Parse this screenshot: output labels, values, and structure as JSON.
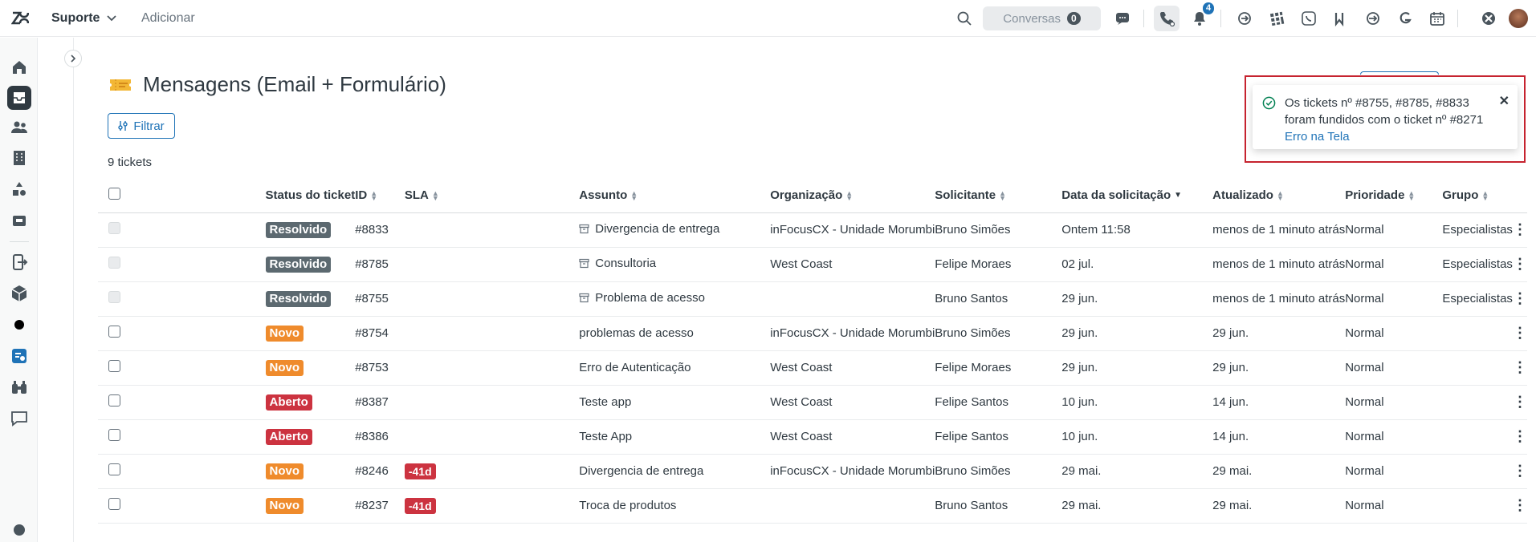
{
  "header": {
    "product": "Suporte",
    "add": "Adicionar",
    "conversations_label": "Conversas",
    "conversations_count": "0",
    "notification_count": "4"
  },
  "view": {
    "title": "Mensagens (Email + Formulário)",
    "filter_label": "Filtrar",
    "ticket_count": "9 tickets"
  },
  "columns": [
    "Status do ticket",
    "ID",
    "SLA",
    "Assunto",
    "Organização",
    "Solicitante",
    "Data da solicitação",
    "Atualizado",
    "Prioridade",
    "Grupo"
  ],
  "rows": [
    {
      "status": "Resolvido",
      "status_color": "#5c6970",
      "id": "#8833",
      "sla": "",
      "archived": true,
      "subject": "Divergencia de entrega",
      "org": "inFocusCX - Unidade Morumbi",
      "requester": "Bruno Simões",
      "requested": "Ontem 11:58",
      "updated": "menos de 1 minuto atrás",
      "priority": "Normal",
      "group": "Especialistas",
      "disabled": true
    },
    {
      "status": "Resolvido",
      "status_color": "#5c6970",
      "id": "#8785",
      "sla": "",
      "archived": true,
      "subject": "Consultoria",
      "org": "West Coast",
      "requester": "Felipe Moraes",
      "requested": "02 jul.",
      "updated": "menos de 1 minuto atrás",
      "priority": "Normal",
      "group": "Especialistas",
      "disabled": true
    },
    {
      "status": "Resolvido",
      "status_color": "#5c6970",
      "id": "#8755",
      "sla": "",
      "archived": true,
      "subject": "Problema de acesso",
      "org": "",
      "requester": "Bruno Santos",
      "requested": "29 jun.",
      "updated": "menos de 1 minuto atrás",
      "priority": "Normal",
      "group": "Especialistas",
      "disabled": true
    },
    {
      "status": "Novo",
      "status_color": "#ef8b2c",
      "id": "#8754",
      "sla": "",
      "archived": false,
      "subject": "problemas de acesso",
      "org": "inFocusCX - Unidade Morumbi",
      "requester": "Bruno Simões",
      "requested": "29 jun.",
      "updated": "29 jun.",
      "priority": "Normal",
      "group": "",
      "disabled": false
    },
    {
      "status": "Novo",
      "status_color": "#ef8b2c",
      "id": "#8753",
      "sla": "",
      "archived": false,
      "subject": "Erro de Autenticação",
      "org": "West Coast",
      "requester": "Felipe Moraes",
      "requested": "29 jun.",
      "updated": "29 jun.",
      "priority": "Normal",
      "group": "",
      "disabled": false
    },
    {
      "status": "Aberto",
      "status_color": "#cc3340",
      "id": "#8387",
      "sla": "",
      "archived": false,
      "subject": "Teste app",
      "org": "West Coast",
      "requester": "Felipe Santos",
      "requested": "10 jun.",
      "updated": "14 jun.",
      "priority": "Normal",
      "group": "",
      "disabled": false
    },
    {
      "status": "Aberto",
      "status_color": "#cc3340",
      "id": "#8386",
      "sla": "",
      "archived": false,
      "subject": "Teste App",
      "org": "West Coast",
      "requester": "Felipe Santos",
      "requested": "10 jun.",
      "updated": "14 jun.",
      "priority": "Normal",
      "group": "",
      "disabled": false
    },
    {
      "status": "Novo",
      "status_color": "#ef8b2c",
      "id": "#8246",
      "sla": "-41d",
      "archived": false,
      "subject": "Divergencia de entrega",
      "org": "inFocusCX - Unidade Morumbi",
      "requester": "Bruno Simões",
      "requested": "29 mai.",
      "updated": "29 mai.",
      "priority": "Normal",
      "group": "",
      "disabled": false
    },
    {
      "status": "Novo",
      "status_color": "#ef8b2c",
      "id": "#8237",
      "sla": "-41d",
      "archived": false,
      "subject": "Troca de produtos",
      "org": "",
      "requester": "Bruno Santos",
      "requested": "29 mai.",
      "updated": "29 mai.",
      "priority": "Normal",
      "group": "",
      "disabled": false
    }
  ],
  "toast": {
    "message": "Os tickets nº #8755, #8785, #8833 foram fundidos com o ticket nº #8271",
    "link": "Erro na Tela"
  },
  "colors": {
    "accent": "#1f73b7",
    "toast_border": "#c6232f"
  }
}
